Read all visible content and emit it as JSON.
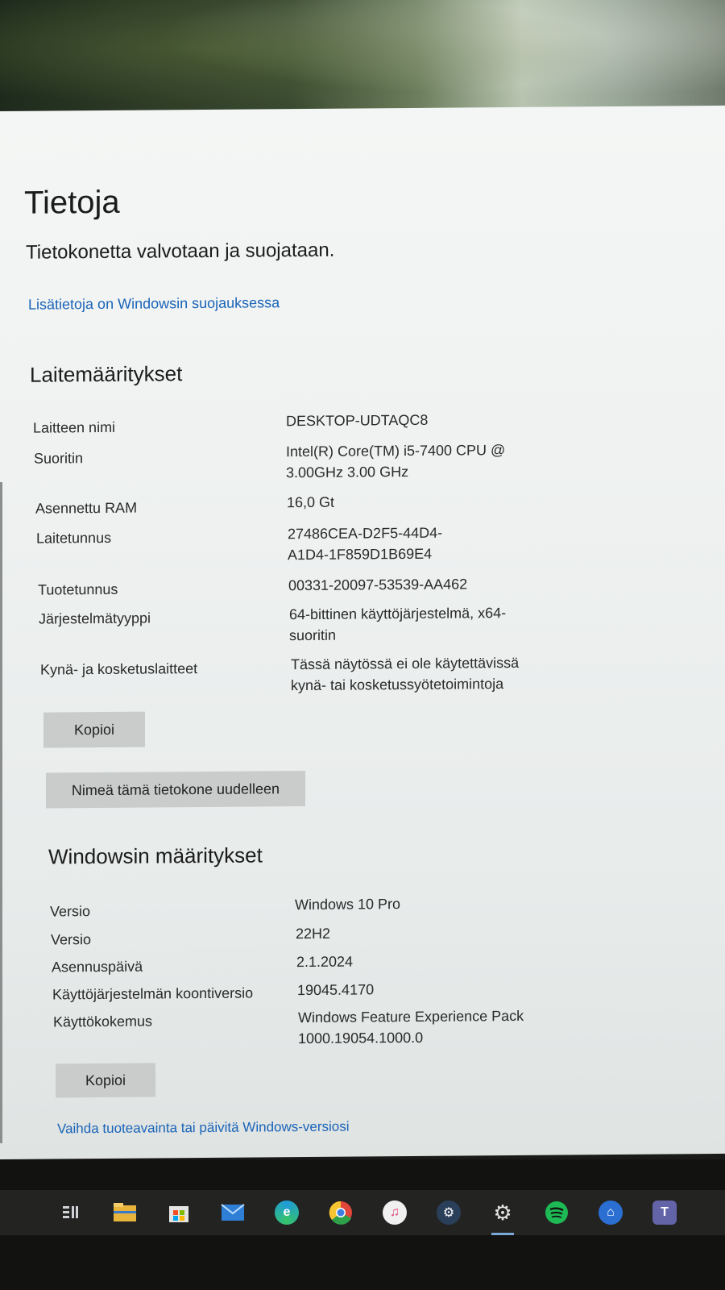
{
  "about": {
    "title": "Tietoja",
    "status": "Tietokonetta valvotaan ja suojataan.",
    "security_link": "Lisätietoja on Windowsin suojauksessa"
  },
  "device_specs": {
    "heading": "Laitemääritykset",
    "rows": [
      {
        "label": "Laitteen nimi",
        "value": "DESKTOP-UDTAQC8"
      },
      {
        "label": "Suoritin",
        "value": "Intel(R) Core(TM) i5-7400 CPU @",
        "value2": "3.00GHz   3.00 GHz"
      },
      {
        "label": "Asennettu RAM",
        "value": "16,0 Gt"
      },
      {
        "label": "Laitetunnus",
        "value": "27486CEA-D2F5-44D4-",
        "value2": "A1D4-1F859D1B69E4"
      },
      {
        "label": "Tuotetunnus",
        "value": "00331-20097-53539-AA462"
      },
      {
        "label": "Järjestelmätyyppi",
        "value": "64-bittinen käyttöjärjestelmä, x64-",
        "value2": "suoritin"
      },
      {
        "label": "Kynä- ja kosketuslaitteet",
        "value": "Tässä näytössä ei ole käytettävissä",
        "value2": "kynä- tai kosketussyötetoimintoja"
      }
    ],
    "copy_button": "Kopioi",
    "rename_button": "Nimeä tämä tietokone uudelleen"
  },
  "windows_specs": {
    "heading": "Windowsin määritykset",
    "rows": [
      {
        "label": "Versio",
        "value": "Windows 10 Pro"
      },
      {
        "label": "Versio",
        "value": "22H2"
      },
      {
        "label": "Asennuspäivä",
        "value": "2.1.2024"
      },
      {
        "label": "Käyttöjärjestelmän koontiversio",
        "value": "19045.4170"
      },
      {
        "label": "Käyttökokemus",
        "value": "Windows Feature Experience Pack",
        "value2": "1000.19054.1000.0"
      }
    ],
    "copy_button": "Kopioi",
    "product_key_link": "Vaihda tuoteavainta tai päivitä Windows-versiosi"
  },
  "taskbar": {
    "icons": [
      {
        "name": "task-view-icon",
        "color": "#cfd3d6"
      },
      {
        "name": "file-explorer-icon",
        "color": "#e8b43c"
      },
      {
        "name": "microsoft-store-icon",
        "color": "#e4e4e4"
      },
      {
        "name": "mail-icon",
        "color": "#2f7fd6"
      },
      {
        "name": "edge-icon",
        "color": "#1f9bd8"
      },
      {
        "name": "chrome-icon",
        "color": "#e0463a"
      },
      {
        "name": "itunes-icon",
        "color": "#f0f0f0"
      },
      {
        "name": "steam-icon",
        "color": "#2a3f5a"
      },
      {
        "name": "settings-icon",
        "color": "#e6e6e6"
      },
      {
        "name": "spotify-icon",
        "color": "#1db954"
      },
      {
        "name": "blue-app-icon",
        "color": "#2b6fd3"
      },
      {
        "name": "teams-icon",
        "color": "#6264a7"
      }
    ]
  }
}
